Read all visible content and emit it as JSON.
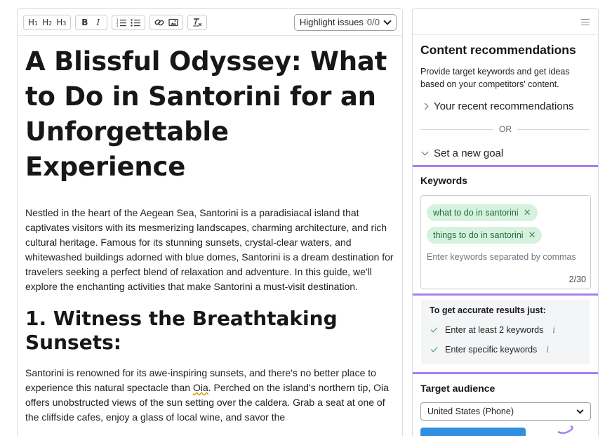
{
  "toolbar": {
    "h1": "H",
    "h1_sub": "1",
    "h2": "H",
    "h2_sub": "2",
    "h3": "H",
    "h3_sub": "3",
    "bold": "B",
    "italic": "I",
    "highlight_label": "Highlight issues",
    "highlight_count": "0/0"
  },
  "document": {
    "title": "A Blissful Odyssey: What to Do in Santorini for an Unforgettable Experience",
    "intro": "Nestled in the heart of the Aegean Sea, Santorini is a paradisiacal island that captivates visitors with its mesmerizing landscapes, charming architecture, and rich cultural heritage. Famous for its stunning sunsets, crystal-clear waters, and whitewashed buildings adorned with blue domes, Santorini is a dream destination for travelers seeking a perfect blend of relaxation and adventure. In this guide, we'll explore the enchanting activities that make Santorini a must-visit destination.",
    "section1_heading": "1. Witness the Breathtaking Sunsets:",
    "section1_text_a": "Santorini is renowned for its awe-inspiring sunsets, and there's no better place to experience this natural spectacle than ",
    "section1_text_oia": "Oia",
    "section1_text_b": ". Perched on the island's northern tip, Oia offers unobstructed views of the sun setting over the caldera. Grab a seat at one of the cliffside cafes, enjoy a glass of local wine, and savor the"
  },
  "sidebar": {
    "title": "Content recommendations",
    "description": "Provide target keywords and get ideas based on your competitors' content.",
    "recent_label": "Your recent recommendations",
    "or_label": "OR",
    "new_goal_label": "Set a new goal",
    "keywords": {
      "title": "Keywords",
      "chips": [
        "what to do in santorini",
        "things to do in santorini"
      ],
      "placeholder": "Enter keywords separated by commas",
      "counter": "2/30"
    },
    "tips": {
      "title": "To get accurate results just:",
      "items": [
        "Enter at least 2 keywords",
        "Enter specific keywords"
      ]
    },
    "target_audience": {
      "title": "Target audience",
      "selected": "United States (Phone)"
    }
  },
  "colors": {
    "highlight_border": "#a97ff0",
    "chip_bg": "#d6f2df",
    "chip_text": "#1e6b3a",
    "check_green": "#2e9e5b",
    "button_blue": "#2f8fe0"
  },
  "icons": [
    "link-icon",
    "image-icon",
    "clear-format-icon",
    "ordered-list-icon",
    "bullet-list-icon",
    "menu-icon",
    "chevron-right-icon",
    "chevron-down-icon",
    "remove-chip-icon",
    "check-icon",
    "info-icon"
  ]
}
